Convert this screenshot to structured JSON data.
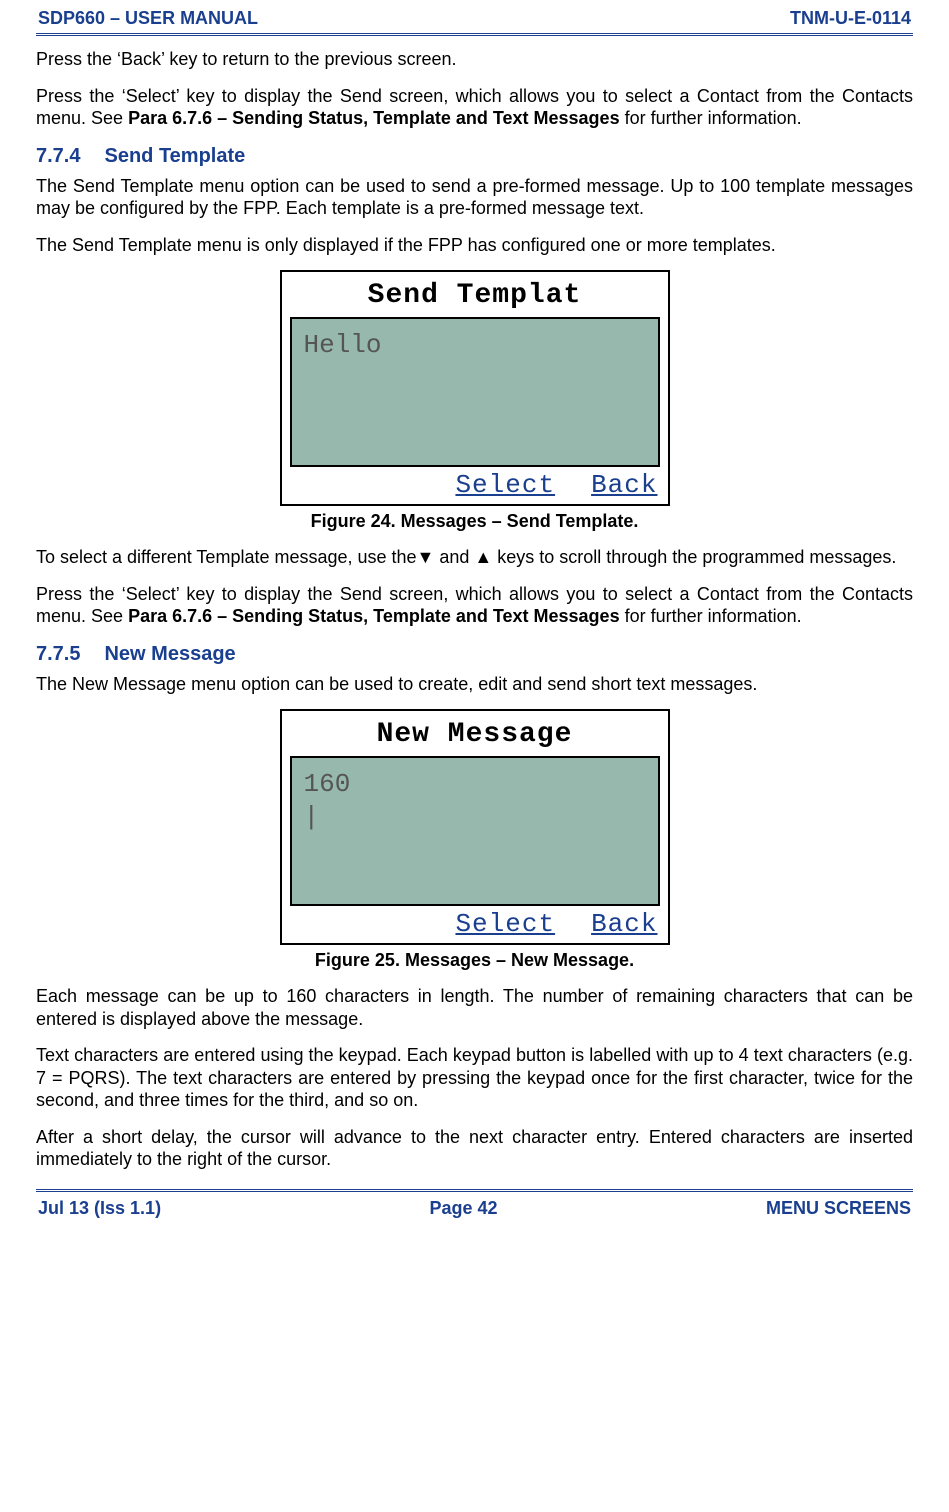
{
  "header": {
    "left": "SDP660 – USER MANUAL",
    "right": "TNM-U-E-0114"
  },
  "footer": {
    "left": "Jul 13 (Iss 1.1)",
    "center": "Page 42",
    "right": "MENU SCREENS"
  },
  "intro": {
    "p1": "Press the ‘Back’ key to return to the previous screen.",
    "p2a": "Press the ‘Select’ key to display the Send screen, which allows you to select a Contact from the Contacts menu.  See ",
    "p2b": "Para 6.7.6 – Sending Status, Template and Text Messages",
    "p2c": " for further information."
  },
  "s774": {
    "num": "7.7.4",
    "title": "Send Template",
    "p1": "The Send Template menu option can be used to send a pre-formed message.  Up to 100 template messages may be configured by the FPP.  Each template is a pre-formed message text.",
    "p2": "The Send Template menu is only displayed if the FPP has configured one or more templates.",
    "device_title": "Send Templat",
    "device_line1": "Hello",
    "soft_select": "Select",
    "soft_back": "Back",
    "figcap": "Figure 24.  Messages – Send Template.",
    "p3": "To select a different Template message, use the▼ and ▲ keys to scroll through the programmed messages.",
    "p4a": "Press the ‘Select’ key to display the Send screen, which allows you to select a Contact from the Contacts menu.  See ",
    "p4b": "Para 6.7.6 – Sending Status, Template and Text Messages",
    "p4c": " for further information."
  },
  "s775": {
    "num": "7.7.5",
    "title": "New Message",
    "p1": "The New Message menu option can be used to create, edit and send short text messages.",
    "device_title": "New Message",
    "device_line1": "160",
    "device_cursor": "|",
    "soft_select": "Select",
    "soft_back": "Back",
    "figcap": "Figure 25.  Messages – New Message.",
    "p2": "Each message can be up to 160 characters in length.  The number of remaining characters that can be entered is displayed above the message.",
    "p3": "Text characters are entered using the keypad.  Each keypad button is labelled with up to 4 text characters (e.g. 7 = PQRS).  The text characters are entered by pressing the keypad once for the first character, twice for the second, and three times for the third, and so on.",
    "p4": "After a short delay, the cursor will advance to the next character entry.  Entered characters are inserted immediately to the right of the cursor."
  }
}
